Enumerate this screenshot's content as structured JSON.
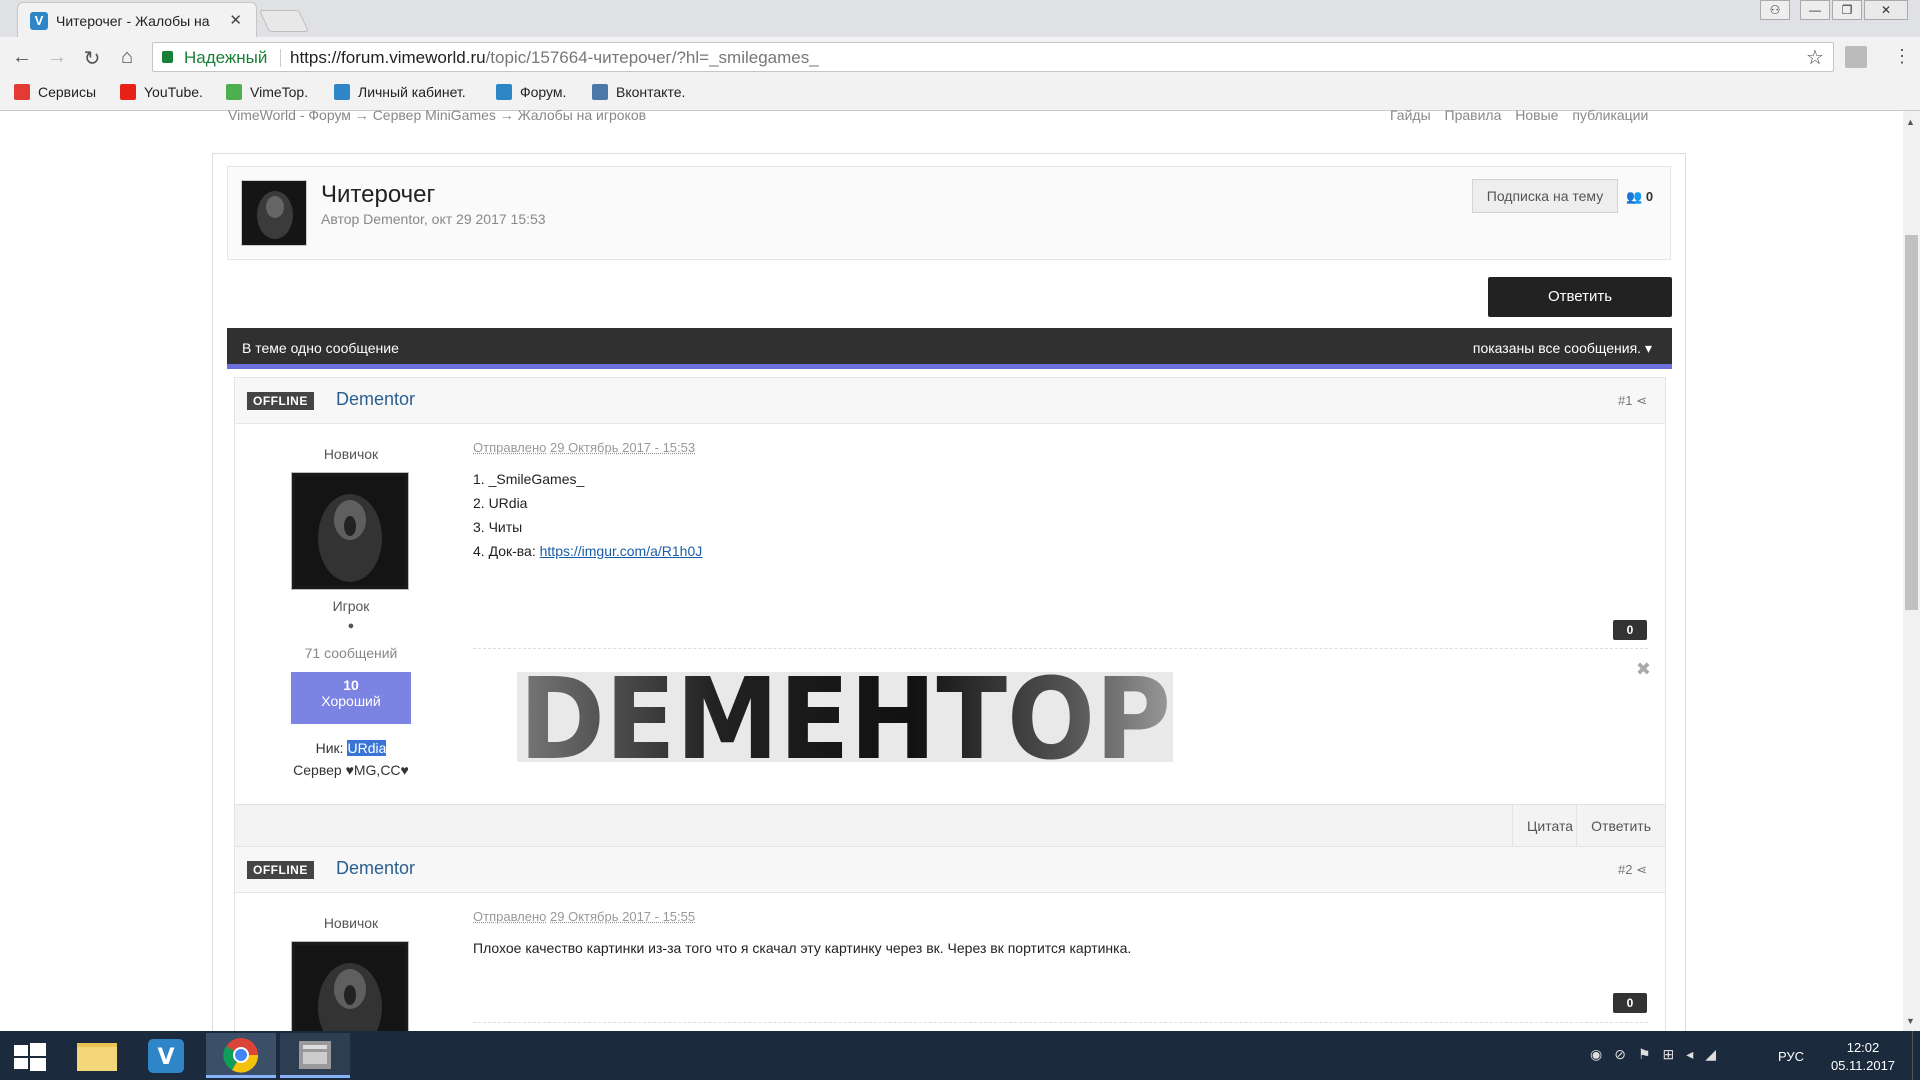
{
  "browser": {
    "tab_title": "Читерочег - Жалобы на",
    "secure_label": "Надежный",
    "url_host": "https://forum.vimeworld.ru",
    "url_path": "/topic/157664-читерочег/?hl=_smilegames_"
  },
  "bookmarks": [
    {
      "label": "Сервисы",
      "color": "#e53935"
    },
    {
      "label": "YouTube.",
      "color": "#e62117"
    },
    {
      "label": "VimeTop.",
      "color": "#4caf50"
    },
    {
      "label": "Личный кабинет.",
      "color": "#2e86c9"
    },
    {
      "label": "Форум.",
      "color": "#2e86c9"
    },
    {
      "label": "Вконтакте.",
      "color": "#4a76a8"
    }
  ],
  "breadcrumb": {
    "text": "VimeWorld - Форум → Сервер MiniGames → Жалобы на игроков",
    "right_links": "Гайды Правила Новые публикации"
  },
  "topic": {
    "title": "Читерочег",
    "meta": "Автор Dementor, окт 29 2017 15:53",
    "subscribe_label": "Подписка на тему",
    "followers": "0",
    "reply_label": "Ответить"
  },
  "bar": {
    "left": "В теме одно сообщение",
    "right": "показаны все сообщения."
  },
  "posts": [
    {
      "status": "OFFLINE",
      "author": "Dementor",
      "num": "#1",
      "rank": "Новичок",
      "group": "Игрок",
      "count": "71 сообщений",
      "rep_value": "10",
      "rep_label": "Хороший",
      "nick_label": "Ник:",
      "nick": "URdia",
      "server": "Сервер ♥MG,CC♥",
      "sent_prefix": "Отправлено",
      "sent_date": "29 Октябрь 2017 - 15:53",
      "lines": [
        "1. _SmileGames_",
        "2. URdia",
        "3. Читы"
      ],
      "proof_prefix": "4. Док-ва: ",
      "proof_link": "https://imgur.com/a/R1h0J",
      "likes": "0",
      "signature_text": "DEMEHTOP",
      "quote_label": "Цитата",
      "reply_label": "Ответить"
    },
    {
      "status": "OFFLINE",
      "author": "Dementor",
      "num": "#2",
      "rank": "Новичок",
      "sent_prefix": "Отправлено",
      "sent_date": "29 Октябрь 2017 - 15:55",
      "text": "Плохое качество картинки из-за того что я скачал эту картинку через вк. Через вк портится картинка.",
      "likes": "0"
    }
  ],
  "taskbar": {
    "lang": "РУС",
    "time": "12:02",
    "date": "05.11.2017"
  }
}
